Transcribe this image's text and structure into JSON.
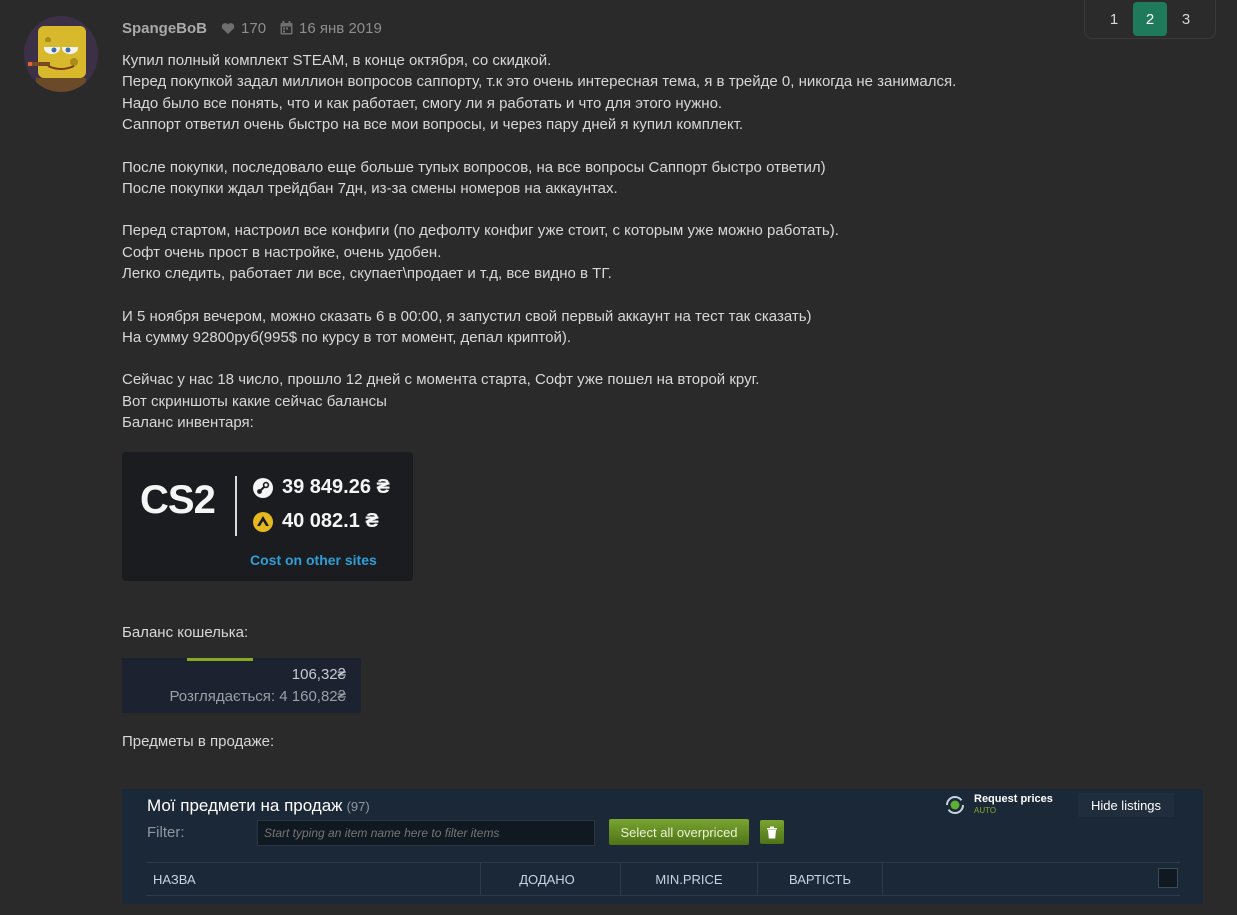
{
  "post": {
    "author": "SpangeBoB",
    "likes": "170",
    "date": "16 янв 2019",
    "paragraphs": [
      [
        "Купил полный комплект STEAM, в конце октября, со скидкой.",
        "Перед покупкой задал миллион вопросов саппорту, т.к это очень интересная тема, я в трейде 0, никогда не занимался.",
        "Надо было все понять, что и как работает, смогу ли я работать и что для этого нужно.",
        "Саппорт ответил очень быстро на все мои вопросы, и через пару дней я купил комплект."
      ],
      [
        "После покупки, последовало еще больше тупых вопросов, на все вопросы Саппорт быстро ответил)",
        "После покупки ждал трейдбан 7дн, из-за смены номеров на аккаунтах."
      ],
      [
        "Перед стартом, настроил все конфиги (по дефолту конфиг уже стоит, с которым уже можно работать).",
        "Софт очень прост в настройке, очень удобен.",
        "Легко следить, работает ли все, скупает\\продает и т.д, все видно в ТГ."
      ],
      [
        "И 5 ноября вечером, можно сказать 6 в 00:00, я запустил свой первый аккаунт на тест так сказать)",
        "На сумму 92800руб(995$ по курсу в тот момент, депал криптой)."
      ],
      [
        "Сейчас у нас 18 число, прошло 12 дней с момента старта, Софт уже пошел на второй круг.",
        "Вот скриншоты какие сейчас балансы",
        "Баланс инвентаря:"
      ]
    ],
    "wallet_label": "Баланс кошелька:",
    "items_label": "Предметы в продаже:"
  },
  "pagination": {
    "pages": [
      "1",
      "2",
      "3"
    ],
    "active": "2"
  },
  "inventory": {
    "game": "CS2",
    "steam_value": "39 849.26 ₴",
    "other_value": "40 082.1 ₴",
    "link": "Cost on other sites"
  },
  "wallet": {
    "balance": "106,32₴",
    "pending": "Розглядається: 4 160,82₴"
  },
  "market": {
    "title": "Мої предмети на продаж",
    "count": "(97)",
    "request_prices": "Request prices",
    "request_mode": "AUTO",
    "hide_listings": "Hide listings",
    "filter_label": "Filter:",
    "filter_placeholder": "Start typing an item name here to filter items",
    "select_overpriced": "Select all overpriced",
    "columns": [
      "НАЗВА",
      "ДОДАНО",
      "MIN.PRICE",
      "ВАРТІСТЬ"
    ]
  },
  "colors": {
    "accent": "#1f7a5c",
    "steam_bg": "#1b2838",
    "steam_green": "#8aa824"
  }
}
